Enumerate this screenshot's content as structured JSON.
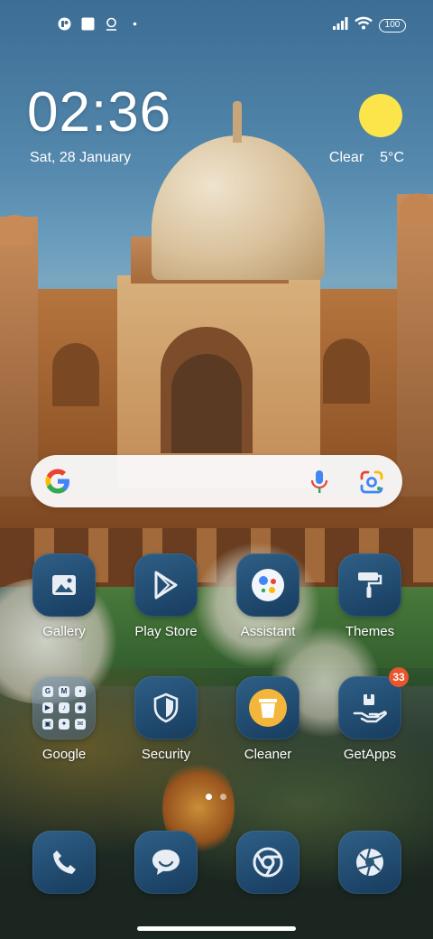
{
  "status_bar": {
    "left_icons": [
      "notification-app-icon",
      "square-notification-icon",
      "location-notification-icon",
      "dot-icon"
    ],
    "right_icons": [
      "signal-icon",
      "wifi-icon"
    ],
    "battery": "100"
  },
  "clock": {
    "time": "02:36",
    "date": "Sat, 28 January"
  },
  "weather": {
    "condition": "Clear",
    "temperature": "5°C",
    "icon": "sun-icon",
    "sun_color": "#FBE54A"
  },
  "search_bar": {
    "logo": "google-g-icon",
    "voice": "microphone-icon",
    "lens": "google-lens-icon"
  },
  "apps": [
    {
      "label": "Gallery",
      "icon": "gallery-icon"
    },
    {
      "label": "Play Store",
      "icon": "play-store-icon"
    },
    {
      "label": "Assistant",
      "icon": "assistant-icon"
    },
    {
      "label": "Themes",
      "icon": "paint-roller-icon"
    },
    {
      "label": "Google",
      "icon": "folder-icon",
      "folder_letters": [
        "G",
        "M",
        "•",
        "▶",
        "♪",
        "◉",
        "▣",
        "✦",
        "✉"
      ]
    },
    {
      "label": "Security",
      "icon": "shield-icon"
    },
    {
      "label": "Cleaner",
      "icon": "trash-bin-icon"
    },
    {
      "label": "GetApps",
      "icon": "hand-box-icon",
      "badge": "33"
    }
  ],
  "dock": [
    {
      "icon": "phone-icon"
    },
    {
      "icon": "message-icon"
    },
    {
      "icon": "chrome-icon"
    },
    {
      "icon": "camera-aperture-icon"
    }
  ],
  "page_indicator": {
    "pages": 2,
    "active": 0
  }
}
